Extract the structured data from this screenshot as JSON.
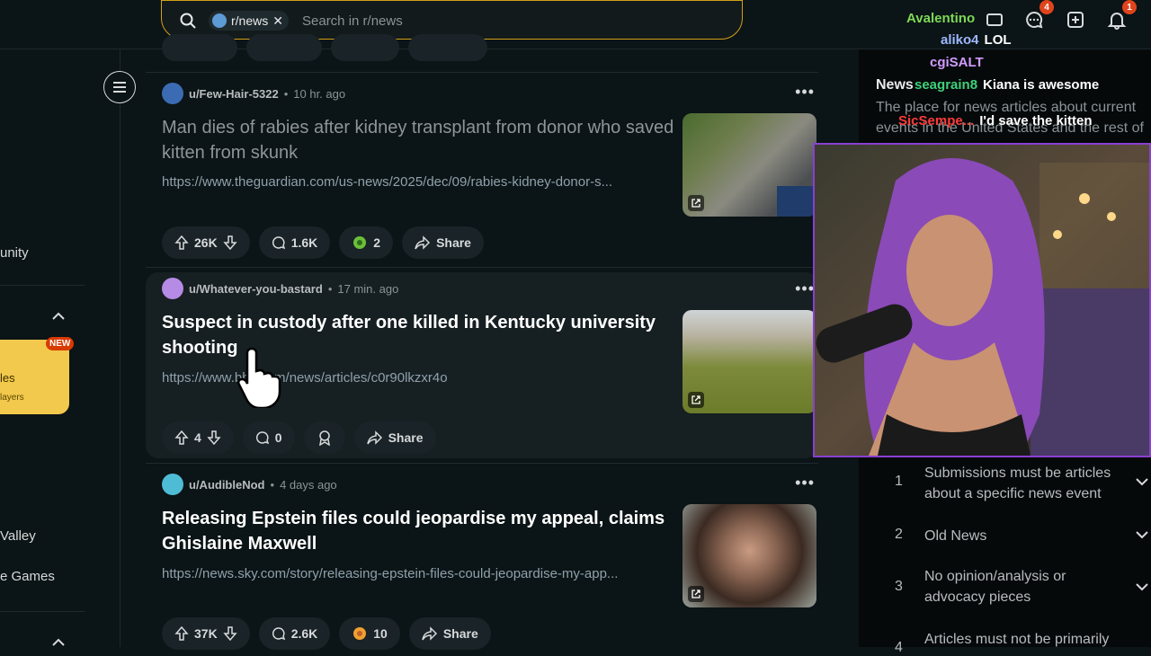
{
  "search": {
    "chip": "r/news",
    "placeholder": "Search in r/news"
  },
  "header": {
    "chat_badge": "4",
    "notif_badge": "1"
  },
  "left_sidebar": {
    "items": [
      "unity",
      "Valley",
      "e Games"
    ],
    "card": {
      "badge": "NEW",
      "line1": "les",
      "line2": "layers"
    }
  },
  "posts": [
    {
      "user": "u/Few-Hair-5322",
      "time": "10 hr. ago",
      "title": "Man dies of rabies after kidney transplant from donor who saved kitten from skunk",
      "link": "https://www.theguardian.com/us-news/2025/dec/09/rabies-kidney-donor-s...",
      "votes": "26K",
      "comments": "1.6K",
      "awards": "2",
      "share": "Share",
      "visited": true
    },
    {
      "user": "u/Whatever-you-bastard",
      "time": "17 min. ago",
      "title": "Suspect in custody after one killed in Kentucky university shooting",
      "link": "https://www.bbc.com/news/articles/c0r90lkzxr4o",
      "votes": "4",
      "comments": "0",
      "share": "Share"
    },
    {
      "user": "u/AudibleNod",
      "time": "4 days ago",
      "title": "Releasing Epstein files could jeopardise my appeal, claims Ghislaine Maxwell",
      "link": "https://news.sky.com/story/releasing-epstein-files-could-jeopardise-my-app...",
      "votes": "37K",
      "comments": "2.6K",
      "awards": "10",
      "share": "Share"
    }
  ],
  "right_sidebar": {
    "title": "News",
    "description": "The place for news articles about current events in the United States and the rest of",
    "rules": [
      {
        "num": "1",
        "text": "Submissions must be articles about a specific news event"
      },
      {
        "num": "2",
        "text": "Old News"
      },
      {
        "num": "3",
        "text": "No opinion/analysis or advocacy pieces"
      },
      {
        "num": "4",
        "text": "Articles must not be primarily"
      }
    ]
  },
  "chat": [
    {
      "user": "Avalentino",
      "msg": "",
      "color": "#7ed957"
    },
    {
      "user": "aliko4",
      "msg": "LOL",
      "color": "#9db7ff"
    },
    {
      "user": "cgiSALT",
      "msg": "",
      "color": "#d19cff"
    },
    {
      "user": "seagrain8",
      "msg": "Kiana is awesome",
      "color": "#3fd17a"
    },
    {
      "user": "SicSempe...",
      "msg": "I'd save the kitten",
      "color": "#ff3b3b"
    }
  ]
}
